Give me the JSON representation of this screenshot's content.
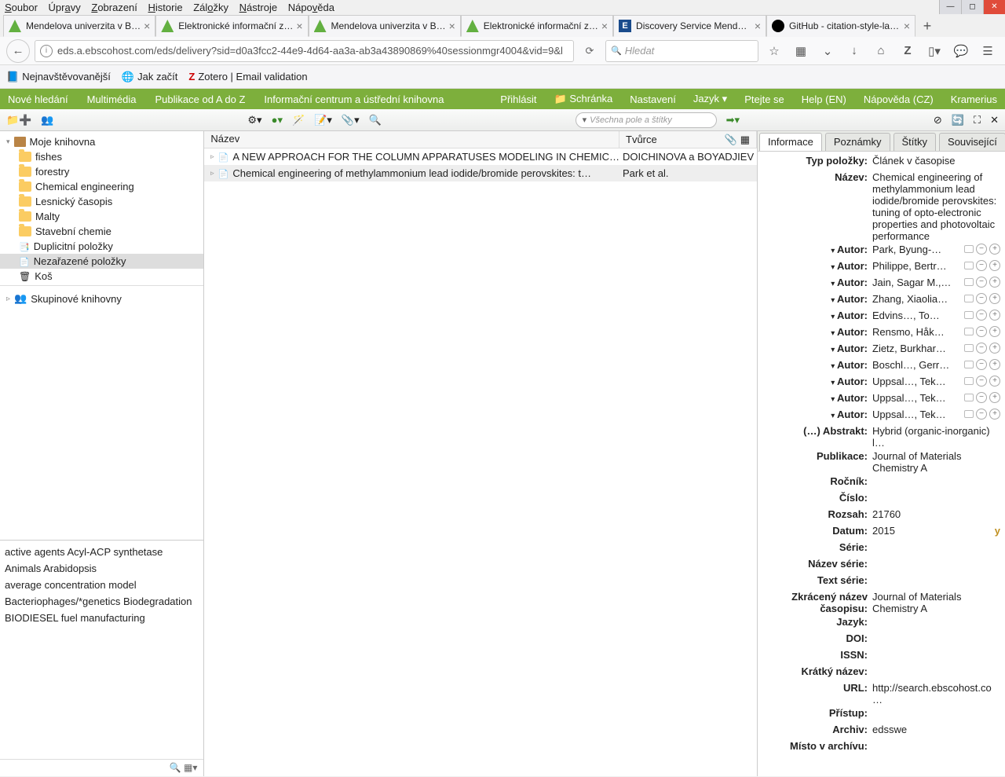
{
  "menubar": [
    "Soubor",
    "Úpravy",
    "Zobrazení",
    "Historie",
    "Záložky",
    "Nástroje",
    "Nápověda"
  ],
  "tabs": [
    {
      "title": "Mendelova univerzita v B…",
      "type": "mendel"
    },
    {
      "title": "Elektronické informační z…",
      "type": "mendel"
    },
    {
      "title": "Mendelova univerzita v B…",
      "type": "mendel"
    },
    {
      "title": "Elektronické informační z…",
      "type": "mendel"
    },
    {
      "title": "Discovery Service Mendel…",
      "type": "ebsco"
    },
    {
      "title": "GitHub - citation-style-la…",
      "type": "github"
    }
  ],
  "url": "eds.a.ebscohost.com/eds/delivery?sid=d0a3fcc2-44e9-4d64-aa3a-ab3a43890869%40sessionmgr4004&vid=9&l",
  "search_placeholder": "Hledat",
  "bookmarks": [
    "Nejnavštěvovanější",
    "Jak začít",
    "Zotero | Email validation"
  ],
  "greenbar_left": [
    "Nové hledání",
    "Multimédia",
    "Publikace od A do Z",
    "Informační centrum a ústřední knihovna"
  ],
  "greenbar_right": [
    "Přihlásit",
    "Schránka",
    "Nastavení",
    "Jazyk ▾",
    "Ptejte se",
    "Help (EN)",
    "Nápověda (CZ)",
    "Kramerius"
  ],
  "zsearch_placeholder": "Všechna pole a štítky",
  "library": {
    "root": "Moje knihovna",
    "folders": [
      "fishes",
      "forestry",
      "Chemical engineering",
      "Lesnický časopis",
      "Malty",
      "Stavební chemie"
    ],
    "dup": "Duplicitní položky",
    "unfiled": "Nezařazené položky",
    "trash": "Koš",
    "groups": "Skupinové knihovny"
  },
  "tags": [
    "active agents   Acyl-ACP synthetase",
    "Animals   Arabidopsis",
    "average concentration model",
    "Bacteriophages/*genetics   Biodegradation",
    "BIODIESEL fuel manufacturing"
  ],
  "columns": {
    "title": "Název",
    "creator": "Tvůrce"
  },
  "items": [
    {
      "title": "A NEW APPROACH FOR THE COLUMN APPARATUSES MODELING IN CHEMIC…",
      "creator": "DOICHINOVA a BOYADJIEV"
    },
    {
      "title": "Chemical engineering of methylammonium lead iodide/bromide perovskites: t…",
      "creator": "Park et al."
    }
  ],
  "info_tabs": [
    "Informace",
    "Poznámky",
    "Štítky",
    "Související"
  ],
  "fields": {
    "typ_polozky_l": "Typ položky:",
    "typ_polozky": "Článek v časopise",
    "nazev_l": "Název:",
    "nazev": "Chemical engineering of methylammonium lead iodide/bromide perovskites: tuning of opto-electronic properties and photovoltaic performance",
    "autor_l": "Autor:",
    "authors": [
      "Park, Byung-…",
      "Philippe, Bertr…",
      "Jain, Sagar M.,…",
      "Zhang, Xiaolia…",
      "Edvins…, To…",
      "Rensmo, Håk…",
      "Zietz, Burkhar…",
      "Boschl…, Gerr…",
      "Uppsal…, Tek…",
      "Uppsal…, Tek…",
      "Uppsal…, Tek…"
    ],
    "abstrakt_l": "(…) Abstrakt:",
    "abstrakt": "Hybrid (organic-inorganic) l…",
    "publikace_l": "Publikace:",
    "publikace": "Journal of Materials Chemistry A",
    "rocnik_l": "Ročník:",
    "rocnik": "",
    "cislo_l": "Číslo:",
    "cislo": "",
    "rozsah_l": "Rozsah:",
    "rozsah": "21760",
    "datum_l": "Datum:",
    "datum": "2015",
    "datum_flag": "y",
    "serie_l": "Série:",
    "serie": "",
    "nazev_serie_l": "Název série:",
    "nazev_serie": "",
    "text_serie_l": "Text série:",
    "text_serie": "",
    "zkr_l": "Zkrácený název časopisu:",
    "zkr": "Journal of Materials Chemistry A",
    "jazyk_l": "Jazyk:",
    "jazyk": "",
    "doi_l": "DOI:",
    "doi": "",
    "issn_l": "ISSN:",
    "issn": "",
    "kratky_l": "Krátký název:",
    "kratky": "",
    "url_l": "URL:",
    "url": "http://search.ebscohost.co…",
    "pristup_l": "Přístup:",
    "pristup": "",
    "archiv_l": "Archiv:",
    "archiv": "edsswe",
    "misto_l": "Místo v archívu:",
    "misto": ""
  }
}
